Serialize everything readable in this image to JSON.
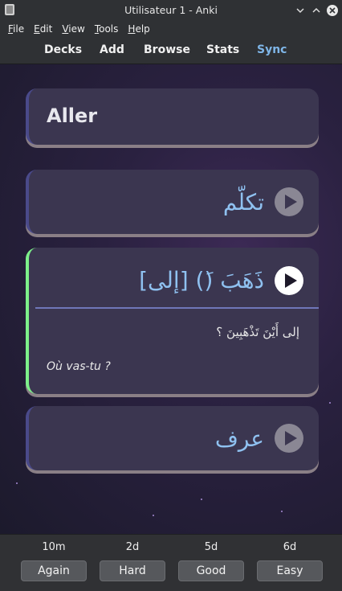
{
  "window": {
    "title": "Utilisateur 1 - Anki"
  },
  "menu": {
    "items": [
      "File",
      "Edit",
      "View",
      "Tools",
      "Help"
    ]
  },
  "toolbar": {
    "items": [
      "Decks",
      "Add",
      "Browse",
      "Stats",
      "Sync"
    ]
  },
  "cards": {
    "front": "Aller",
    "option1": "تكلّم",
    "answer_word": "ذَهَبَ (َ) [إلى]",
    "example_ar": "إلى أَيْنَ تَذْهَبِينَ ؟",
    "example_fr": "Où vas-tu ?",
    "option3": "عرف"
  },
  "answer_bar": {
    "again": {
      "interval": "10m",
      "label": "Again"
    },
    "hard": {
      "interval": "2d",
      "label": "Hard"
    },
    "good": {
      "interval": "5d",
      "label": "Good"
    },
    "easy": {
      "interval": "6d",
      "label": "Easy"
    }
  },
  "colors": {
    "accent_active": "#7df08a",
    "sync_link": "#7fb6e8",
    "arabic_text": "#8fc1f0"
  }
}
